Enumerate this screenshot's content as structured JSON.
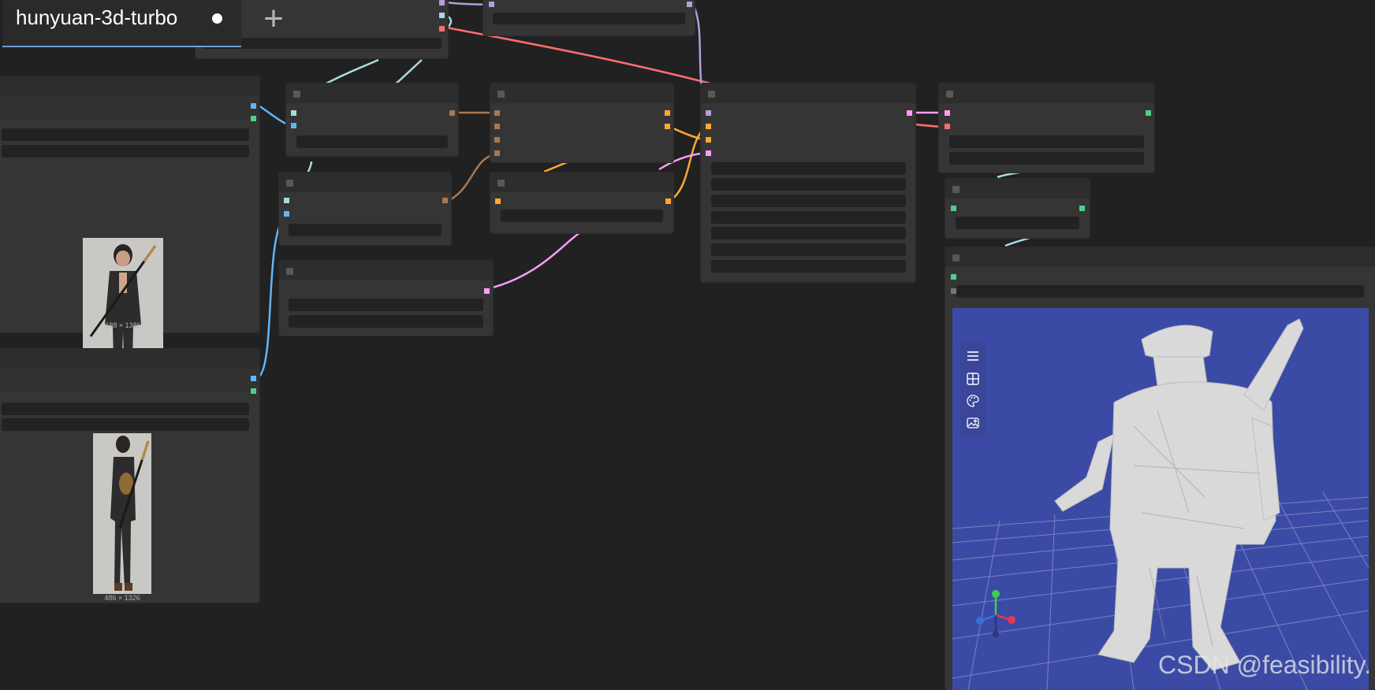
{
  "tabs": [
    {
      "title": "hunyuan-3d-turbo",
      "unsaved": true
    }
  ],
  "images": [
    {
      "size_label": "688 × 1386",
      "subject": "front view of person with sword on back"
    },
    {
      "size_label": "486 × 1326",
      "subject": "side view of person with sword on back"
    }
  ],
  "viewer": {
    "tools": [
      {
        "icon": "menu-icon"
      },
      {
        "icon": "grid-icon"
      },
      {
        "icon": "palette-icon"
      },
      {
        "icon": "image-icon"
      }
    ],
    "background_color": "#3b4ba5",
    "model_color": "#d8d8d8",
    "gizmo": {
      "x_color": "#e8384f",
      "y_color": "#3ecf4c",
      "z_color": "#3a6fd8"
    }
  },
  "link_colors": {
    "image": "#64b5f6",
    "mask": "#4fd08a",
    "latent": "#ff9cf9",
    "model": "#b39ddb",
    "vae": "#ff6e6e",
    "clip_vision": "#a8dadc",
    "conditioning": "#ffa931",
    "brown": "#a97851"
  },
  "watermark": "CSDN @feasibility."
}
